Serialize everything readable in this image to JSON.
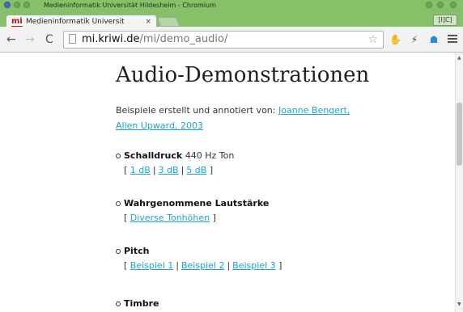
{
  "window": {
    "title": "Medieninformatik Universität Hildesheim - Chromium",
    "profile_label": "[I]C]",
    "controls": {
      "minimize": "⊖",
      "maximize": "⊙",
      "close": "⊗"
    }
  },
  "tab": {
    "favicon_text": "mi",
    "title": "Medieninformatik Universit",
    "close_glyph": "×"
  },
  "toolbar": {
    "back_glyph": "←",
    "forward_glyph": "→",
    "reload_glyph": "C",
    "url_domain": "mi.kriwi.de",
    "url_path": "/mi/demo_audio/",
    "star_glyph": "☆",
    "extensions": [
      "puzzle-icon",
      "plug-icon",
      "ghostery-icon"
    ]
  },
  "content": {
    "heading": "Audio-Demonstrationen",
    "intro_text": "Beispiele erstellt und annotiert von:",
    "intro_link_1": "Joanne Bengert,",
    "intro_link_2": "Allen Upward, 2003",
    "items": [
      {
        "title": "Schalldruck",
        "suffix": "440 Hz Ton",
        "links": [
          "1 dB",
          "3 dB",
          "5 dB"
        ]
      },
      {
        "title": "Wahrgenommene Lautstärke",
        "suffix": "",
        "links": [
          "Diverse Tonhöhen"
        ]
      },
      {
        "title": "Pitch",
        "suffix": "",
        "links": [
          "Beispiel 1",
          "Beispiel 2",
          "Beispiel 3"
        ]
      },
      {
        "title": "Timbre",
        "suffix": "",
        "links": []
      }
    ],
    "bracket_open": "[",
    "bracket_close": "]",
    "separator": "|"
  },
  "colors": {
    "chrome_green": "#86c16a",
    "link": "#1aa3d4",
    "text": "#333333"
  }
}
